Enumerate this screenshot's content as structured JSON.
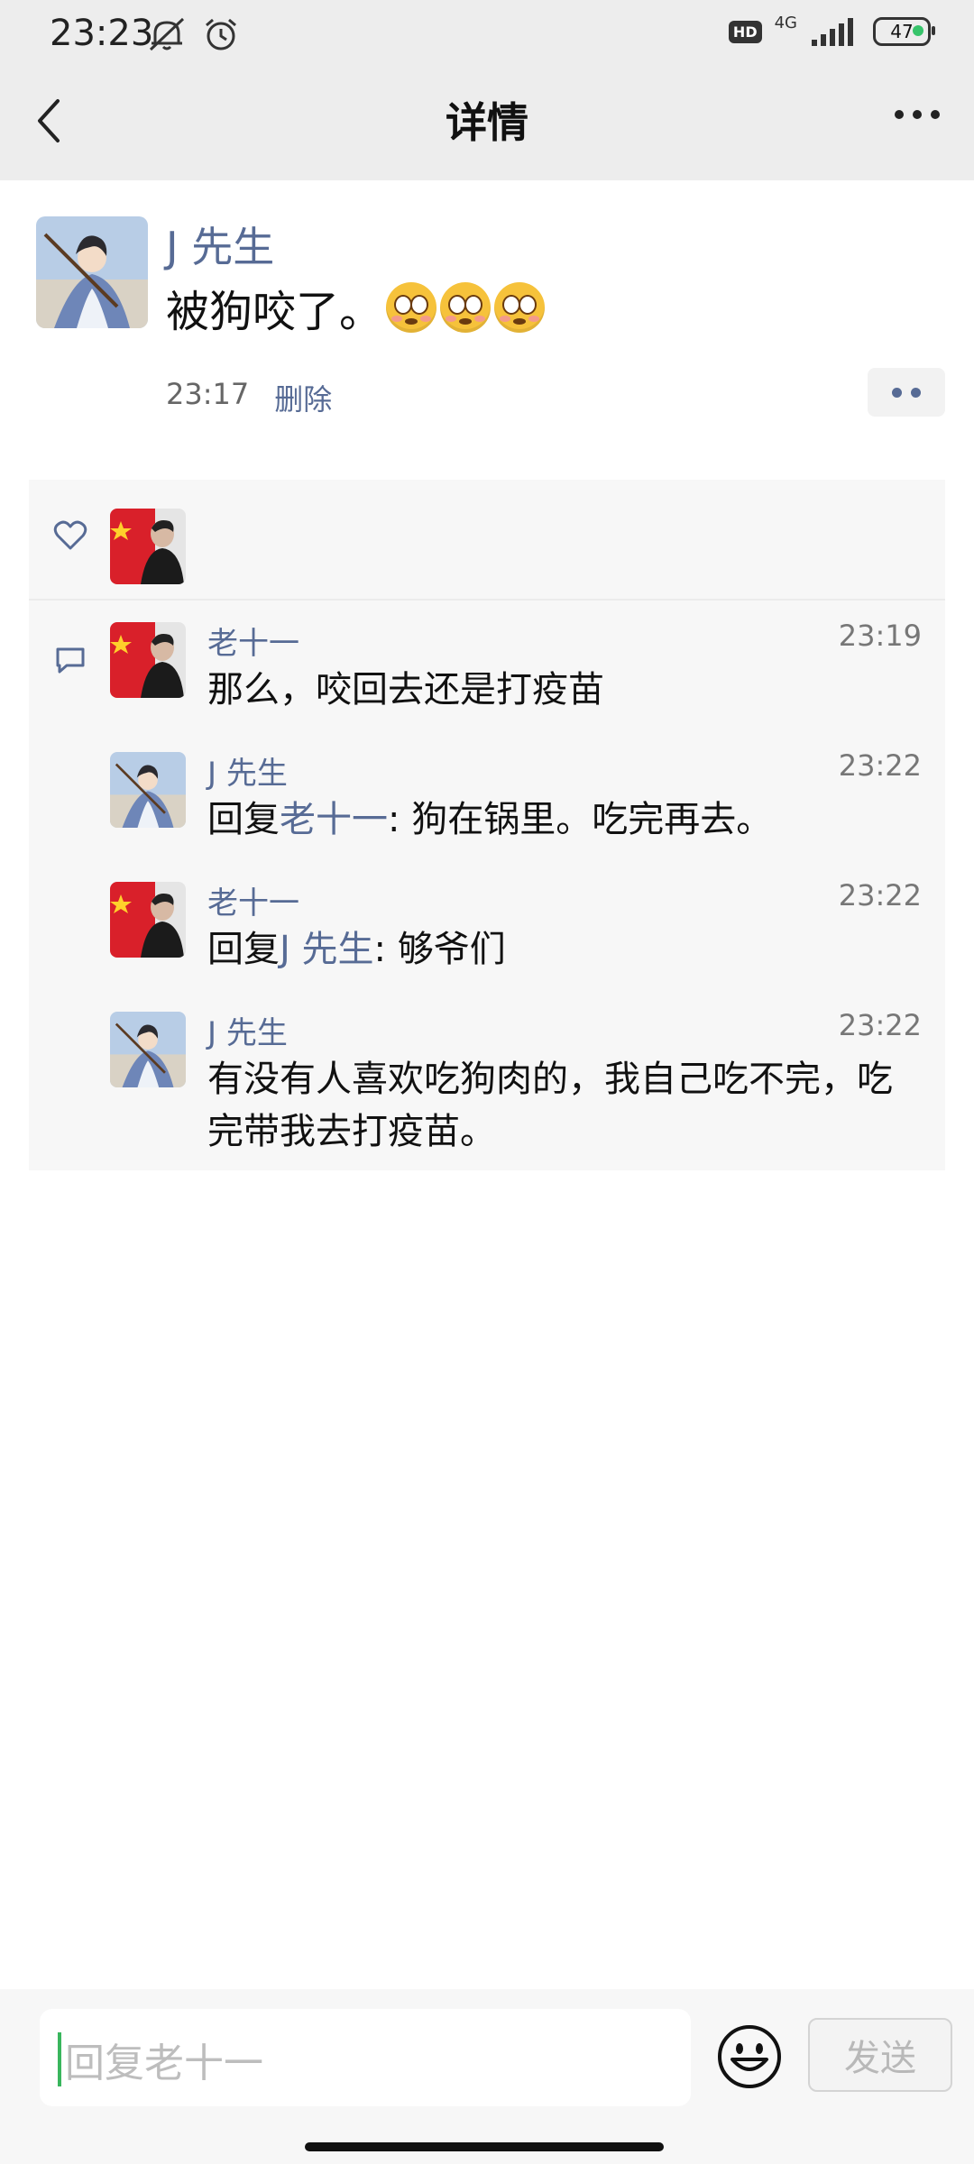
{
  "status_bar": {
    "time": "23:23",
    "hd": "HD",
    "network": "4G",
    "battery": "47",
    "icons": [
      "mute-bell-icon",
      "alarm-icon",
      "signal-icon"
    ]
  },
  "header": {
    "title": "详情",
    "back_icon": "chevron-left-icon",
    "more_icon": "more-dots-icon"
  },
  "post": {
    "author": "J 先生",
    "text": "被狗咬了。",
    "emoji_count": 3,
    "emoji_name": "flushed-face-emoji",
    "time": "23:17",
    "delete_label": "删除"
  },
  "likes": {
    "icon": "heart-icon",
    "avatars": [
      "laoshiyi-avatar"
    ]
  },
  "comments": [
    {
      "name": "老十一",
      "time": "23:19",
      "reply_prefix": "",
      "reply_to": "",
      "separator": "",
      "text": "那么，咬回去还是打疫苗",
      "avatar": "flag"
    },
    {
      "name": "J 先生",
      "time": "23:22",
      "reply_prefix": "回复",
      "reply_to": "老十一",
      "separator": ": ",
      "text": "狗在锅里。吃完再去。",
      "avatar": "portrait"
    },
    {
      "name": "老十一",
      "time": "23:22",
      "reply_prefix": "回复",
      "reply_to": "J 先生",
      "separator": ": ",
      "text": "够爷们",
      "avatar": "flag"
    },
    {
      "name": "J 先生",
      "time": "23:22",
      "reply_prefix": "",
      "reply_to": "",
      "separator": "",
      "text": "有没有人喜欢吃狗肉的，我自己吃不完，吃完带我去打疫苗。",
      "avatar": "portrait"
    }
  ],
  "input": {
    "placeholder": "回复老十一",
    "emoji_icon": "smiley-icon",
    "send_label": "发送"
  }
}
